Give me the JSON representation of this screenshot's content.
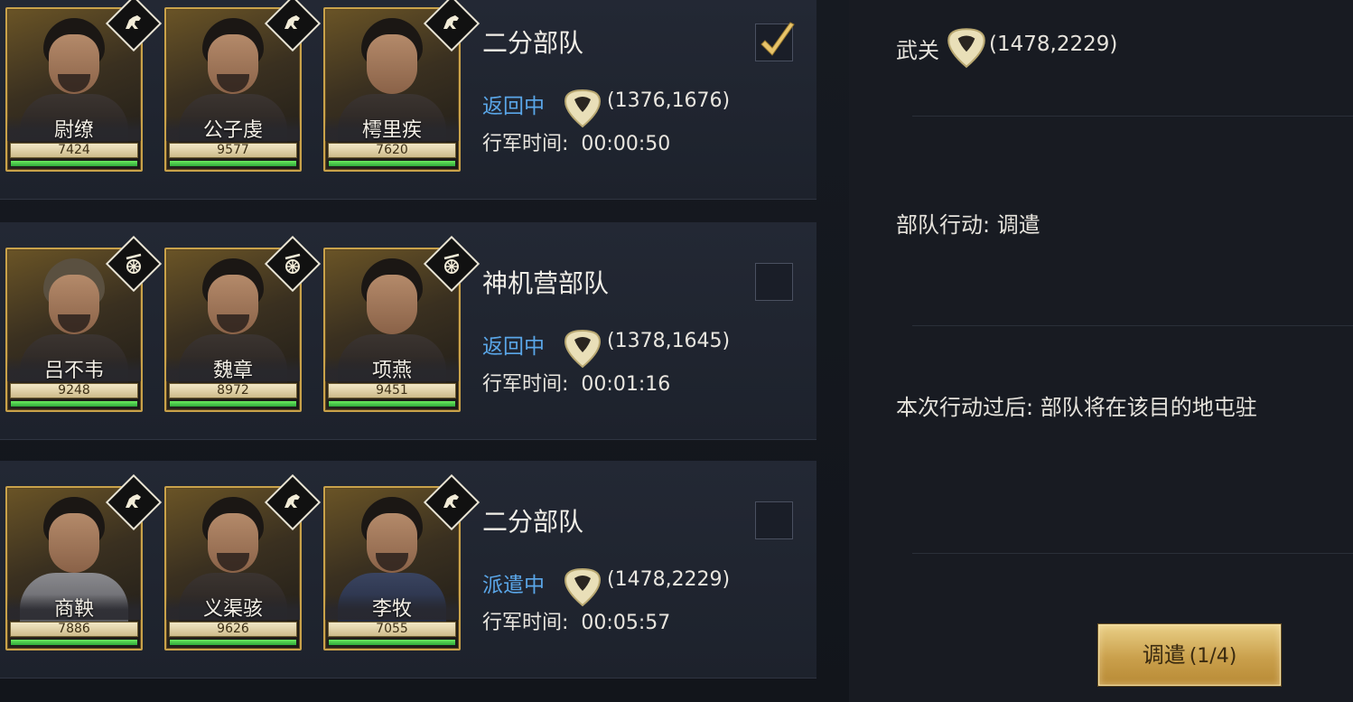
{
  "troops": [
    {
      "name": "二分部队",
      "status": "返回中",
      "coord": "(1376,1676)",
      "time_label": "行军时间:",
      "time": "00:00:50",
      "checked": true,
      "class_icon": "cavalry-icon",
      "generals": [
        {
          "name": "尉缭",
          "power": "7424"
        },
        {
          "name": "公子虔",
          "power": "9577"
        },
        {
          "name": "樗里疾",
          "power": "7620"
        }
      ]
    },
    {
      "name": "神机营部队",
      "status": "返回中",
      "coord": "(1378,1645)",
      "time_label": "行军时间:",
      "time": "00:01:16",
      "checked": false,
      "class_icon": "siege-cart-icon",
      "generals": [
        {
          "name": "吕不韦",
          "power": "9248"
        },
        {
          "name": "魏章",
          "power": "8972"
        },
        {
          "name": "项燕",
          "power": "9451"
        }
      ]
    },
    {
      "name": "二分部队",
      "status": "派遣中",
      "coord": "(1478,2229)",
      "time_label": "行军时间:",
      "time": "00:05:57",
      "checked": false,
      "class_icon": "cavalry-icon",
      "generals": [
        {
          "name": "商鞅",
          "power": "7886"
        },
        {
          "name": "义渠骇",
          "power": "9626"
        },
        {
          "name": "李牧",
          "power": "7055"
        }
      ]
    }
  ],
  "detail": {
    "destination_name": "武关",
    "destination_coord": "(1478,2229)",
    "action_text": "部队行动:  调遣",
    "after_text": "本次行动过后:  部队将在该目的地屯驻"
  },
  "dispatch_button": {
    "label": "调遣",
    "count": "(1/4)"
  },
  "colors": {
    "status_blue": "#5aa6e8",
    "gold_border": "#c9a24a",
    "hp_green": "#3fc24a"
  }
}
